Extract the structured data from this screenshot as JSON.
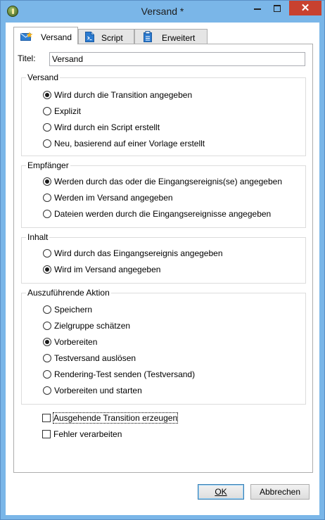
{
  "window": {
    "title": "Versand *"
  },
  "tabs": [
    {
      "label": "Versand",
      "icon": "envelope-star-icon",
      "active": true
    },
    {
      "label": "Script",
      "icon": "script-file-icon",
      "active": false
    },
    {
      "label": "Erweitert",
      "icon": "clipboard-icon",
      "active": false
    }
  ],
  "title_field": {
    "label": "Titel:",
    "value": "Versand"
  },
  "versand": {
    "title": "Versand",
    "options": [
      {
        "label": "Wird durch die Transition angegeben",
        "selected": true
      },
      {
        "label": "Explizit",
        "selected": false
      },
      {
        "label": "Wird durch ein Script erstellt",
        "selected": false
      },
      {
        "label": "Neu, basierend auf einer Vorlage erstellt",
        "selected": false
      }
    ]
  },
  "empfaenger": {
    "title": "Empfänger",
    "options": [
      {
        "label": "Werden durch das oder die Eingangsereignis(se) angegeben",
        "selected": true
      },
      {
        "label": "Werden im Versand angegeben",
        "selected": false
      },
      {
        "label": "Dateien werden durch die Eingangsereignisse angegeben",
        "selected": false
      }
    ]
  },
  "inhalt": {
    "title": "Inhalt",
    "options": [
      {
        "label": "Wird durch das Eingangsereignis angegeben",
        "selected": false
      },
      {
        "label": "Wird im Versand angegeben",
        "selected": true
      }
    ]
  },
  "aktion": {
    "title": "Auszuführende Aktion",
    "options": [
      {
        "label": "Speichern",
        "selected": false
      },
      {
        "label": "Zielgruppe schätzen",
        "selected": false
      },
      {
        "label": "Vorbereiten",
        "selected": true
      },
      {
        "label": "Testversand auslösen",
        "selected": false
      },
      {
        "label": "Rendering-Test senden (Testversand)",
        "selected": false
      },
      {
        "label": "Vorbereiten und starten",
        "selected": false
      }
    ]
  },
  "checkboxes": [
    {
      "label": "Ausgehende Transition erzeugen",
      "checked": false
    },
    {
      "label": "Fehler verarbeiten",
      "checked": false
    }
  ],
  "buttons": {
    "ok": "OK",
    "cancel": "Abbrechen"
  }
}
